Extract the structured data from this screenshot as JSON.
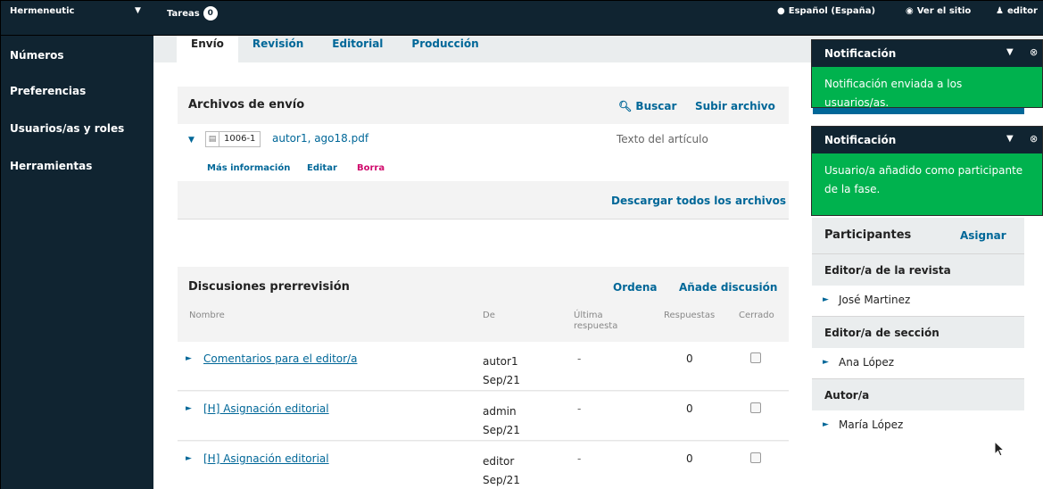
{
  "topbar": {
    "brand": "Hermeneutic",
    "tasks_label": "Tareas",
    "tasks_count": "0",
    "language": "Español (España)",
    "view_site": "Ver el sitio",
    "user": "editor"
  },
  "sidebar": {
    "items": [
      {
        "label": "Números"
      },
      {
        "label": "Preferencias"
      },
      {
        "label": "Usuarios/as y roles"
      },
      {
        "label": "Herramientas"
      }
    ]
  },
  "tabs": [
    {
      "label": "Envío"
    },
    {
      "label": "Revisión"
    },
    {
      "label": "Editorial"
    },
    {
      "label": "Producción"
    }
  ],
  "submission_files": {
    "title": "Archivos de envío",
    "search_label": "Buscar",
    "upload_label": "Subir archivo",
    "file": {
      "id": "1006-1",
      "name": "autor1, ago18.pdf",
      "type": "Texto del artículo",
      "more_info": "Más información",
      "edit": "Editar",
      "delete": "Borra"
    },
    "download_all": "Descargar todos los archivos"
  },
  "discussions": {
    "title": "Discusiones prerrevisión",
    "order_label": "Ordena",
    "add_label": "Añade discusión",
    "columns": {
      "name": "Nombre",
      "from": "De",
      "last_reply_1": "Última",
      "last_reply_2": "respuesta",
      "replies": "Respuestas",
      "closed": "Cerrado"
    },
    "rows": [
      {
        "name": "Comentarios para el editor/a",
        "from_user": "autor1",
        "from_date": "Sep/21",
        "last": "-",
        "replies": "0"
      },
      {
        "name": "[H] Asignación editorial",
        "from_user": "admin",
        "from_date": "Sep/21",
        "last": "-",
        "replies": "0"
      },
      {
        "name": "[H] Asignación editorial",
        "from_user": "editor",
        "from_date": "Sep/21",
        "last": "-",
        "replies": "0"
      }
    ]
  },
  "notifications": [
    {
      "title": "Notificación",
      "body": "Notificación enviada a los usuarios/as."
    },
    {
      "title": "Notificación",
      "body": "Usuario/a añadido como participante de la fase."
    }
  ],
  "participants": {
    "title": "Participantes",
    "assign": "Asignar",
    "groups": [
      {
        "label": "Editor/a de la revista",
        "member": "José Martinez"
      },
      {
        "label": "Editor/a de sección",
        "member": "Ana López"
      },
      {
        "label": "Autor/a",
        "member": "María López"
      }
    ]
  },
  "colors": {
    "nav_bg": "#102431",
    "link": "#006798",
    "notification_green": "#00b24e",
    "delete_red": "#d00a6c"
  }
}
